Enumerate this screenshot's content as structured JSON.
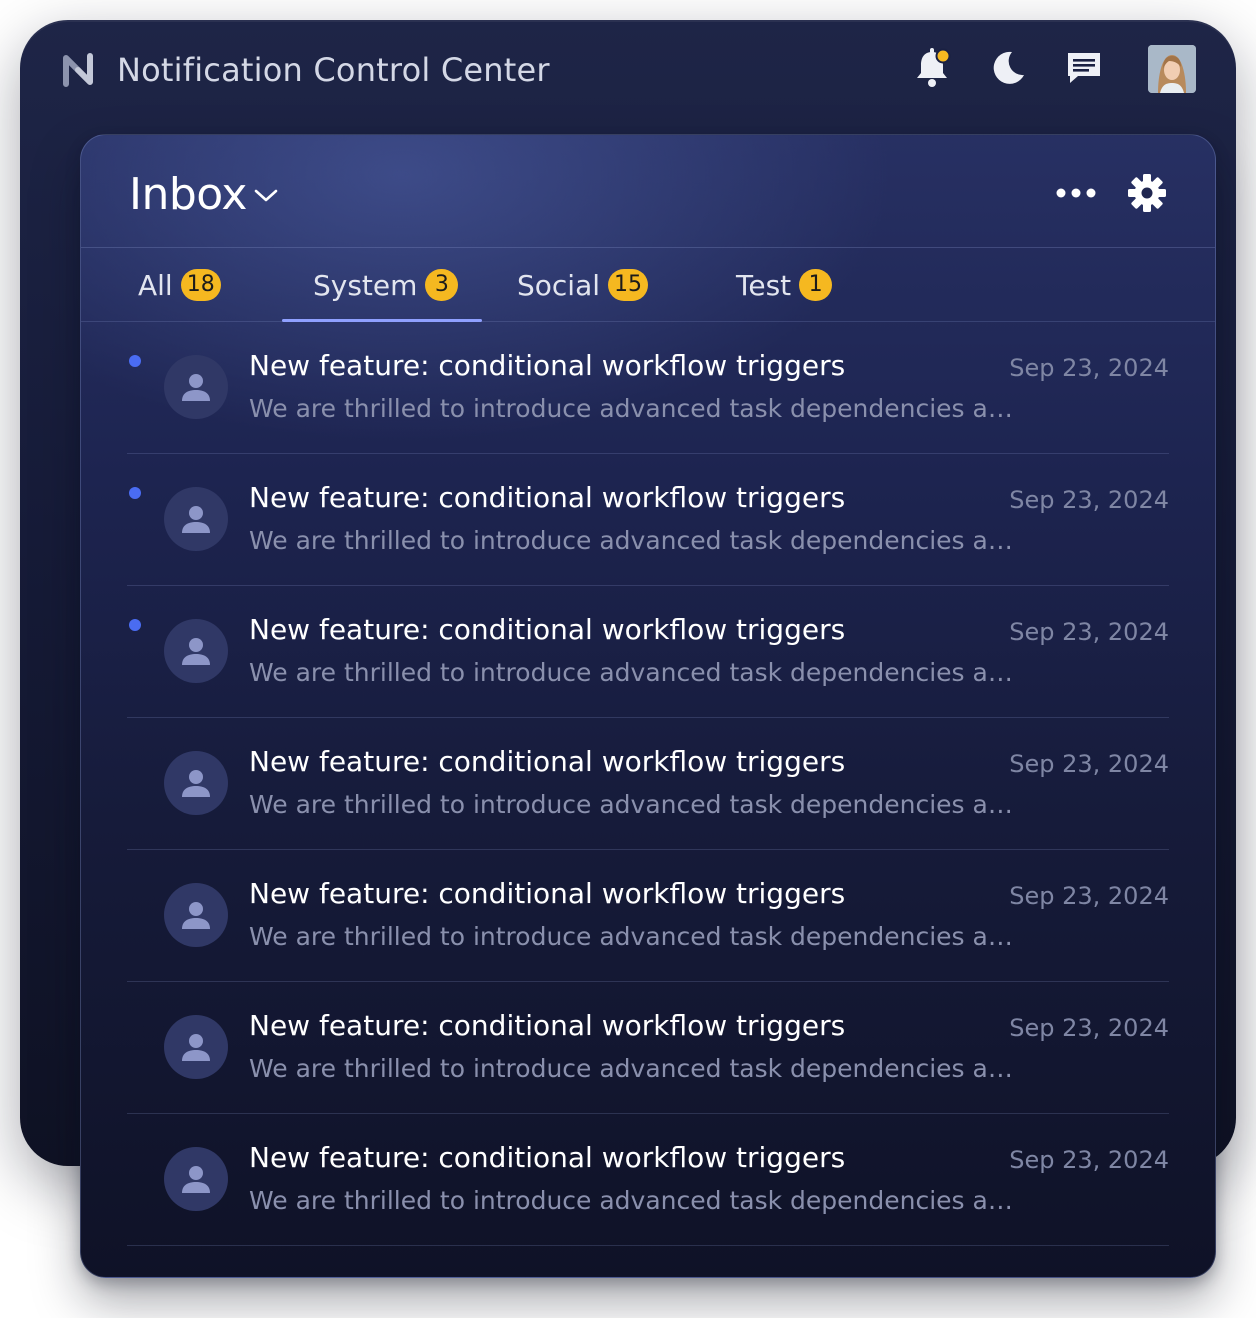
{
  "app": {
    "title": "Notification Control Center"
  },
  "topbar": {
    "icons": [
      "bell-icon",
      "moon-icon",
      "message-icon"
    ],
    "notification_dot_color": "#f5b820"
  },
  "inbox": {
    "title": "Inbox",
    "tabs": [
      {
        "label": "All",
        "count": "18"
      },
      {
        "label": "System",
        "count": "3",
        "active": true
      },
      {
        "label": "Social",
        "count": "15"
      },
      {
        "label": "Test",
        "count": "1"
      }
    ],
    "notifications": [
      {
        "title": "New feature: conditional workflow triggers",
        "body": "We are thrilled to introduce advanced task dependencies and workflow automation features to help your team ship faster.",
        "date": "Sep 23, 2024",
        "unread": true
      },
      {
        "title": "New feature: conditional workflow triggers",
        "body": "We are thrilled to introduce advanced task dependencies and workflow automation features to help your team ship faster.",
        "date": "Sep 23, 2024",
        "unread": true
      },
      {
        "title": "New feature: conditional workflow triggers",
        "body": "We are thrilled to introduce advanced task dependencies and workflow automation features to help your team ship faster.",
        "date": "Sep 23, 2024",
        "unread": true
      },
      {
        "title": "New feature: conditional workflow triggers",
        "body": "We are thrilled to introduce advanced task dependencies and workflow automation features to help your team ship faster.",
        "date": "Sep 23, 2024",
        "unread": false
      },
      {
        "title": "New feature: conditional workflow triggers",
        "body": "We are thrilled to introduce advanced task dependencies and workflow automation features to help your team ship faster.",
        "date": "Sep 23, 2024",
        "unread": false
      },
      {
        "title": "New feature: conditional workflow triggers",
        "body": "We are thrilled to introduce advanced task dependencies and workflow automation features to help your team ship faster.",
        "date": "Sep 23, 2024",
        "unread": false
      },
      {
        "title": "New feature: conditional workflow triggers",
        "body": "We are thrilled to introduce advanced task dependencies and workflow automation features to help your team ship faster.",
        "date": "Sep 23, 2024",
        "unread": false
      }
    ]
  },
  "colors": {
    "accent": "#4a6cf2",
    "badge": "#f5b820",
    "tab_underline": "#8fa0ff"
  }
}
